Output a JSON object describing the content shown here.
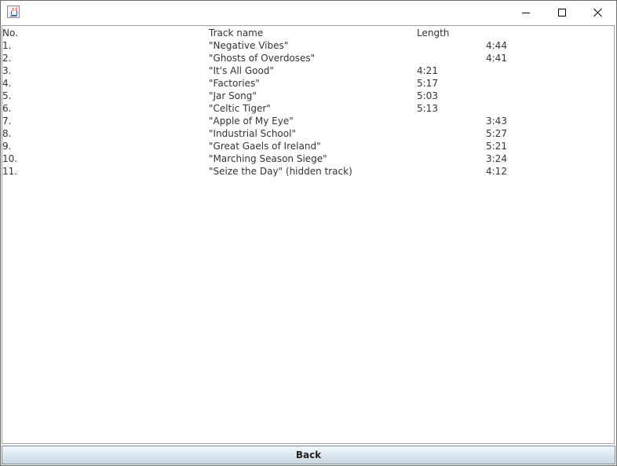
{
  "window": {
    "title": ""
  },
  "table": {
    "headers": {
      "no": "No.",
      "name": "Track name",
      "length": "Length"
    },
    "rows": [
      {
        "no": "1.",
        "name": "\"Negative Vibes\"",
        "length": "",
        "length_alt": "4:44"
      },
      {
        "no": "2.",
        "name": "\"Ghosts of Overdoses\"",
        "length": "",
        "length_alt": "4:41"
      },
      {
        "no": "3.",
        "name": "\"It's All Good\"",
        "length": "4:21",
        "length_alt": ""
      },
      {
        "no": "4.",
        "name": "\"Factories\"",
        "length": "5:17",
        "length_alt": ""
      },
      {
        "no": "5.",
        "name": "\"Jar Song\"",
        "length": "5:03",
        "length_alt": ""
      },
      {
        "no": "6.",
        "name": "\"Celtic Tiger\"",
        "length": "5:13",
        "length_alt": ""
      },
      {
        "no": "7.",
        "name": "\"Apple of My Eye\"",
        "length": "",
        "length_alt": "3:43"
      },
      {
        "no": "8.",
        "name": "\"Industrial School\"",
        "length": "",
        "length_alt": "5:27"
      },
      {
        "no": "9.",
        "name": "\"Great Gaels of Ireland\"",
        "length": "",
        "length_alt": "5:21"
      },
      {
        "no": "10.",
        "name": "\"Marching Season Siege\"",
        "length": "",
        "length_alt": "3:24"
      },
      {
        "no": "11.",
        "name": "\"Seize the Day\" (hidden track)",
        "length": "",
        "length_alt": "4:12"
      }
    ]
  },
  "footer": {
    "back_label": "Back"
  }
}
